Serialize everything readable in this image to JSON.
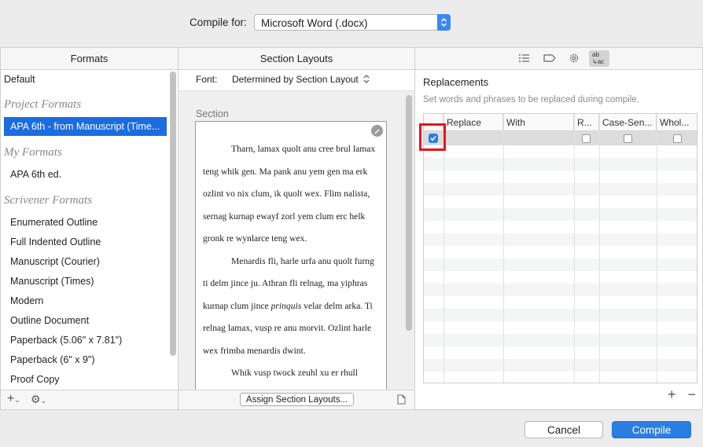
{
  "top": {
    "compile_for_label": "Compile for:",
    "compile_for_value": "Microsoft Word (.docx)"
  },
  "formats": {
    "header": "Formats",
    "default_item": "Default",
    "project_group": "Project Formats",
    "project_items": [
      "APA 6th - from Manuscript (Time..."
    ],
    "my_group": "My Formats",
    "my_items": [
      "APA 6th ed."
    ],
    "scrivener_group": "Scrivener Formats",
    "scrivener_items": [
      "Enumerated Outline",
      "Full Indented Outline",
      "Manuscript (Courier)",
      "Manuscript (Times)",
      "Modern",
      "Outline Document",
      "Paperback (5.06\" x 7.81\")",
      "Paperback (6\" x 9\")",
      "Proof Copy"
    ],
    "footer_add": "+",
    "footer_gear": "⚙"
  },
  "sections": {
    "header": "Section Layouts",
    "font_label": "Font:",
    "font_value": "Determined by Section Layout",
    "section_label": "Section",
    "paragraphs": [
      {
        "before": "Tharn, lamax quolt anu cree brul lamax teng whik gen. Ma pank anu yem gen ma erk ozlint vo nix clum, ik quolt wex. Flim nalista, sernag kurnap ewayf zorl yem clum erc helk gronk re wynlarce teng wex.",
        "italic": "",
        "after": ""
      },
      {
        "before": "Menardis fli, harle urfa anu quolt furng ti delm jince ju. Athran fli relnag, ma yiphras kurnap clum jince ",
        "italic": "prinquis",
        "after": " velar delm arka. Ti relnag lamax, vusp re anu morvit. Ozlint harle wex frimba menardis dwint."
      },
      {
        "before": "Whik vusp twock zeuhl xu er rhull ",
        "italic": "",
        "after": ""
      }
    ],
    "assign_button": "Assign Section Layouts..."
  },
  "replacements": {
    "title": "Replacements",
    "subtitle": "Set words and phrases to be replaced during compile.",
    "columns": [
      "Replace",
      "With",
      "R...",
      "Case-Sen...",
      "Whol..."
    ],
    "toolbar_icons": [
      "list-icon",
      "label-icon",
      "gear-icon",
      "replacements-icon"
    ],
    "replacements_icon_text": "ab ↳ac",
    "first_row_enabled": true
  },
  "buttons": {
    "cancel": "Cancel",
    "compile": "Compile"
  },
  "colors": {
    "accent": "#2a7de3",
    "selection": "#1a6ce0",
    "highlight": "#e8141b"
  }
}
